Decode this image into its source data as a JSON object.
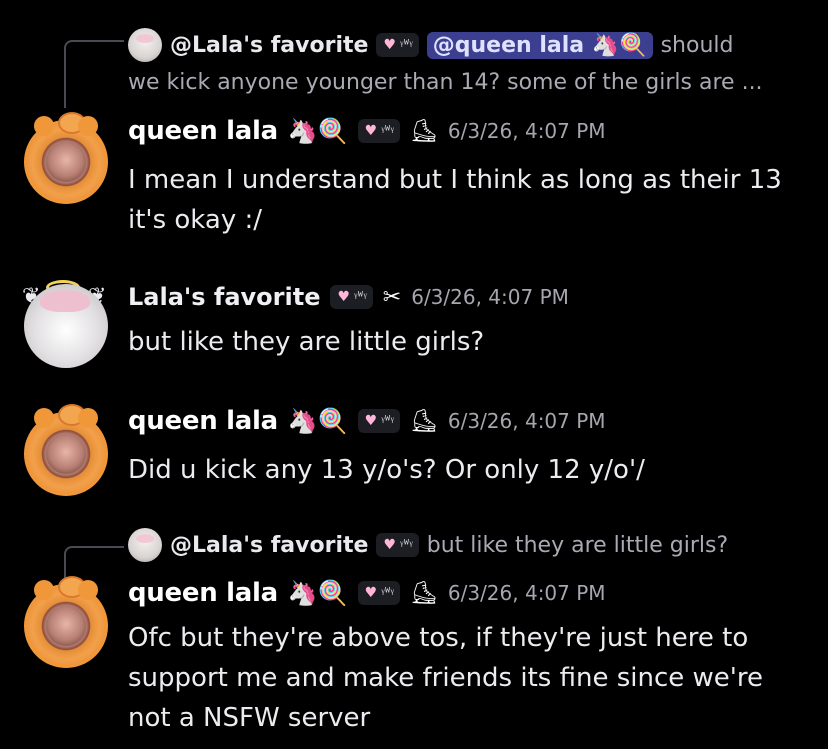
{
  "reply1": {
    "name": "@Lala's favorite",
    "tag_text": "ᵞᵂᵞ",
    "mention": "@queen lala",
    "mention_emoji": "🦄🍭",
    "text_tail": "should",
    "text_cont": "we kick anyone younger than 14? some of the girls are ..."
  },
  "messages": [
    {
      "name": "queen lala",
      "name_emoji": "🦄🍭",
      "tag_text": "ᵞᵂᵞ",
      "deco": "⛸",
      "time": "6/3/26, 4:07 PM",
      "text": "I mean I understand but I think as long as their 13\nit's okay :/"
    },
    {
      "name": "Lala's favorite",
      "tag_text": "ᵞᵂᵞ",
      "deco": "✂",
      "time": "6/3/26, 4:07 PM",
      "text": "but like they are little girls?"
    },
    {
      "name": "queen lala",
      "name_emoji": "🦄🍭",
      "tag_text": "ᵞᵂᵞ",
      "deco": "⛸",
      "time": "6/3/26, 4:07 PM",
      "text": "Did u kick any 13 y/o's? Or only 12 y/o'/"
    },
    {
      "name": "queen lala",
      "name_emoji": "🦄🍭",
      "tag_text": "ᵞᵂᵞ",
      "deco": "⛸",
      "time": "6/3/26, 4:07 PM",
      "text": "Ofc but they're above tos, if they're just here to\nsupport me and make friends its fine since we're\nnot a NSFW server"
    }
  ],
  "reply2": {
    "name": "@Lala's favorite",
    "tag_text": "ᵞᵂᵞ",
    "text": "but like they are little girls?"
  },
  "colors": {
    "background": "#000000",
    "mention_bg": "#3c3f8f",
    "tag_bg": "#1d1e23",
    "timestamp": "#a5a6ae"
  },
  "icons": {
    "tag": "heart-icon",
    "queen_deco": "skate-icon",
    "lala_deco": "scissors-icon"
  }
}
